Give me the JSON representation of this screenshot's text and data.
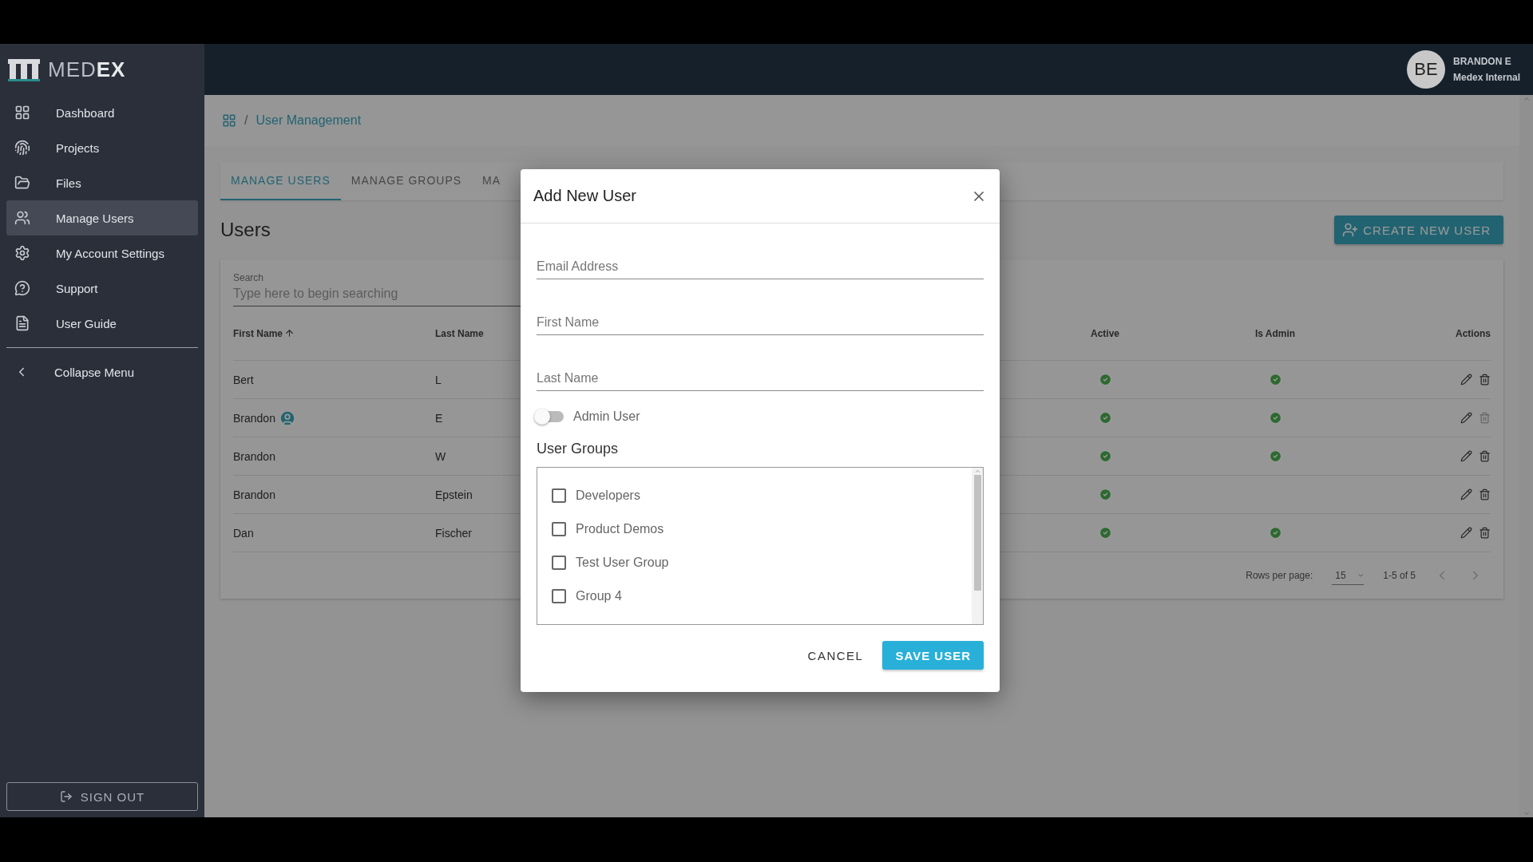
{
  "sidebar": {
    "logo": {
      "light": "MED",
      "bold": "EX"
    },
    "items": [
      {
        "label": "Dashboard",
        "selected": false
      },
      {
        "label": "Projects",
        "selected": false
      },
      {
        "label": "Files",
        "selected": false
      },
      {
        "label": "Manage Users",
        "selected": true
      },
      {
        "label": "My Account Settings",
        "selected": false
      },
      {
        "label": "Support",
        "selected": false
      },
      {
        "label": "User Guide",
        "selected": false
      }
    ],
    "collapse": "Collapse Menu",
    "sign_out": "SIGN OUT"
  },
  "header": {
    "avatar": "BE",
    "user": "BRANDON E",
    "org": "Medex Internal"
  },
  "breadcrumb": {
    "separator": "/",
    "current": "User Management"
  },
  "tabs": [
    {
      "label": "MANAGE USERS",
      "selected": true
    },
    {
      "label": "MANAGE GROUPS",
      "selected": false
    },
    {
      "label": "MA",
      "selected": false
    }
  ],
  "title": "Users",
  "create_button": "CREATE NEW USER",
  "search": {
    "label": "Search",
    "placeholder": "Type here to begin searching"
  },
  "table": {
    "columns": [
      {
        "label": "First Name",
        "sorted": true
      },
      {
        "label": "Last Name",
        "sorted": false
      },
      {
        "label": "Active",
        "sorted": false
      },
      {
        "label": "Is Admin",
        "sorted": false
      },
      {
        "label": "Actions",
        "sorted": false
      }
    ],
    "rows": [
      {
        "first": "Bert",
        "last": "L",
        "current_user": false,
        "active": true,
        "admin": true,
        "delete_disabled": false
      },
      {
        "first": "Brandon",
        "last": "E",
        "current_user": true,
        "active": true,
        "admin": true,
        "delete_disabled": true
      },
      {
        "first": "Brandon",
        "last": "W",
        "current_user": false,
        "active": true,
        "admin": true,
        "delete_disabled": false
      },
      {
        "first": "Brandon",
        "last": "Epstein",
        "current_user": false,
        "active": true,
        "admin": false,
        "delete_disabled": false
      },
      {
        "first": "Dan",
        "last": "Fischer",
        "current_user": false,
        "active": true,
        "admin": true,
        "delete_disabled": false
      }
    ],
    "rows_per_page_label": "Rows per page:",
    "rows_per_page": "15",
    "range": "1-5 of 5"
  },
  "dialog": {
    "title": "Add New User",
    "fields": [
      {
        "placeholder": "Email Address"
      },
      {
        "placeholder": "First Name"
      },
      {
        "placeholder": "Last Name"
      }
    ],
    "admin_switch": {
      "label": "Admin User",
      "on": false
    },
    "groups_title": "User Groups",
    "groups": [
      {
        "label": "Developers",
        "checked": false
      },
      {
        "label": "Product Demos",
        "checked": false
      },
      {
        "label": "Test User Group",
        "checked": false
      },
      {
        "label": "Group 4",
        "checked": false
      }
    ],
    "cancel": "CANCEL",
    "save": "SAVE USER"
  }
}
